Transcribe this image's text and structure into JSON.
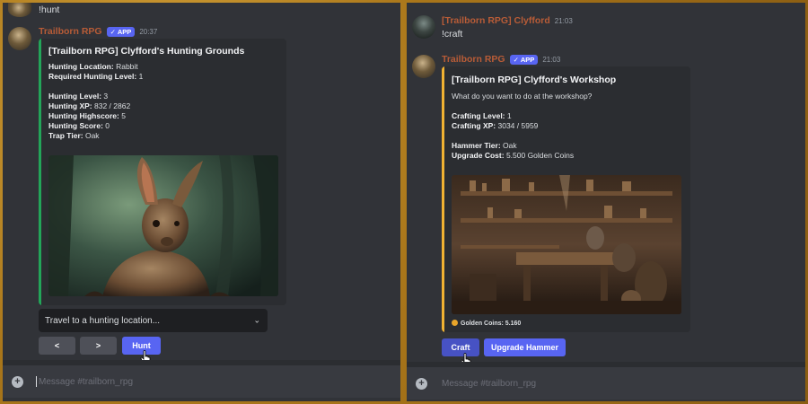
{
  "left": {
    "previous_message": "!hunt",
    "bot_author": "Trailborn RPG",
    "app_badge": "APP",
    "timestamp": "20:37",
    "embed": {
      "accent_color": "#23a559",
      "title": "[Trailborn RPG] Clyfford's Hunting Grounds",
      "fields": [
        {
          "label": "Hunting Location:",
          "value": "Rabbit"
        },
        {
          "label": "Required Hunting Level:",
          "value": "1"
        },
        {
          "label": "Hunting Level:",
          "value": "3"
        },
        {
          "label": "Hunting XP:",
          "value": "832 / 2862"
        },
        {
          "label": "Hunting Highscore:",
          "value": "5"
        },
        {
          "label": "Hunting Score:",
          "value": "0"
        },
        {
          "label": "Trap Tier:",
          "value": "Oak"
        }
      ],
      "image": "rabbit-forest-illustration"
    },
    "select_placeholder": "Travel to a hunting location...",
    "buttons": {
      "prev": "<",
      "next": ">",
      "hunt": "Hunt"
    },
    "composer_placeholder": "Message #trailborn_rpg"
  },
  "right": {
    "user_author": "[Trailborn RPG] Clyfford",
    "user_timestamp": "21:03",
    "user_message": "!craft",
    "bot_author": "Trailborn RPG",
    "app_badge": "APP",
    "timestamp": "21:03",
    "embed": {
      "accent_color": "#f0b232",
      "title": "[Trailborn RPG] Clyfford's Workshop",
      "description": "What do you want to do at the workshop?",
      "fields": [
        {
          "label": "Crafting Level:",
          "value": "1"
        },
        {
          "label": "Crafting XP:",
          "value": "3034 / 5959"
        },
        {
          "label": "Hammer Tier:",
          "value": "Oak"
        },
        {
          "label": "Upgrade Cost:",
          "value": "5.500 Golden Coins"
        }
      ],
      "image": "workshop-illustration",
      "footer": "Golden Coins: 5.160"
    },
    "buttons": {
      "craft": "Craft",
      "upgrade": "Upgrade Hammer"
    },
    "composer_placeholder": "Message #trailborn_rpg"
  },
  "colors": {
    "background": "#313338",
    "embed": "#2b2d31",
    "blurple": "#5865f2",
    "bot_name": "#b85c37",
    "frame": "#b8871f"
  }
}
